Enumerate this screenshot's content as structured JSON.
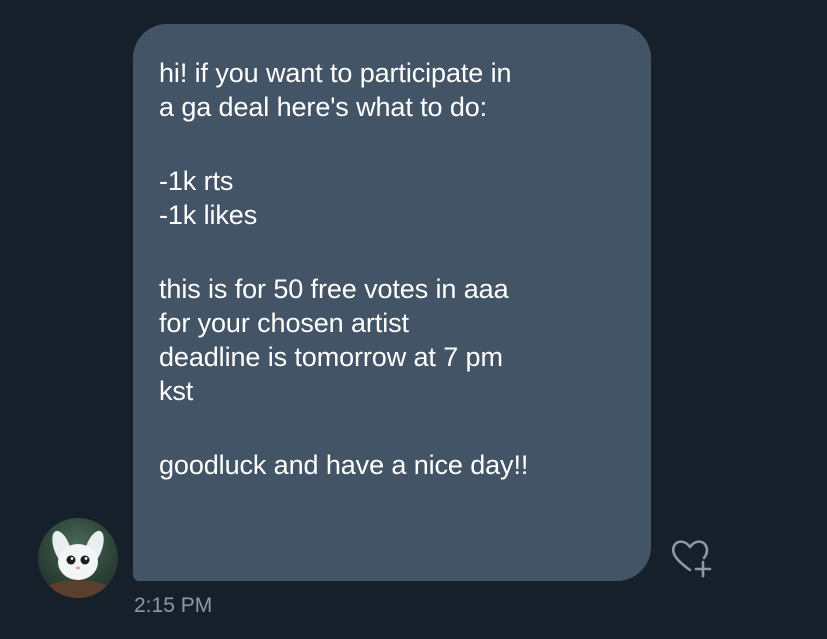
{
  "message": {
    "lines": [
      "hi! if you want to participate in",
      "a ga deal here's what to do:",
      "",
      "-1k rts",
      "-1k likes",
      "",
      "this is for 50 free votes in aaa",
      "for your chosen artist",
      "deadline is tomorrow at 7 pm",
      "kst",
      "",
      "goodluck and have a nice day!!"
    ],
    "timestamp": "2:15 PM"
  },
  "icons": {
    "avatar": "bunny-avatar",
    "reaction": "heart-plus-icon"
  },
  "colors": {
    "background": "#15202b",
    "bubble": "#425466",
    "text": "#ffffff",
    "muted": "#8b98a5"
  }
}
